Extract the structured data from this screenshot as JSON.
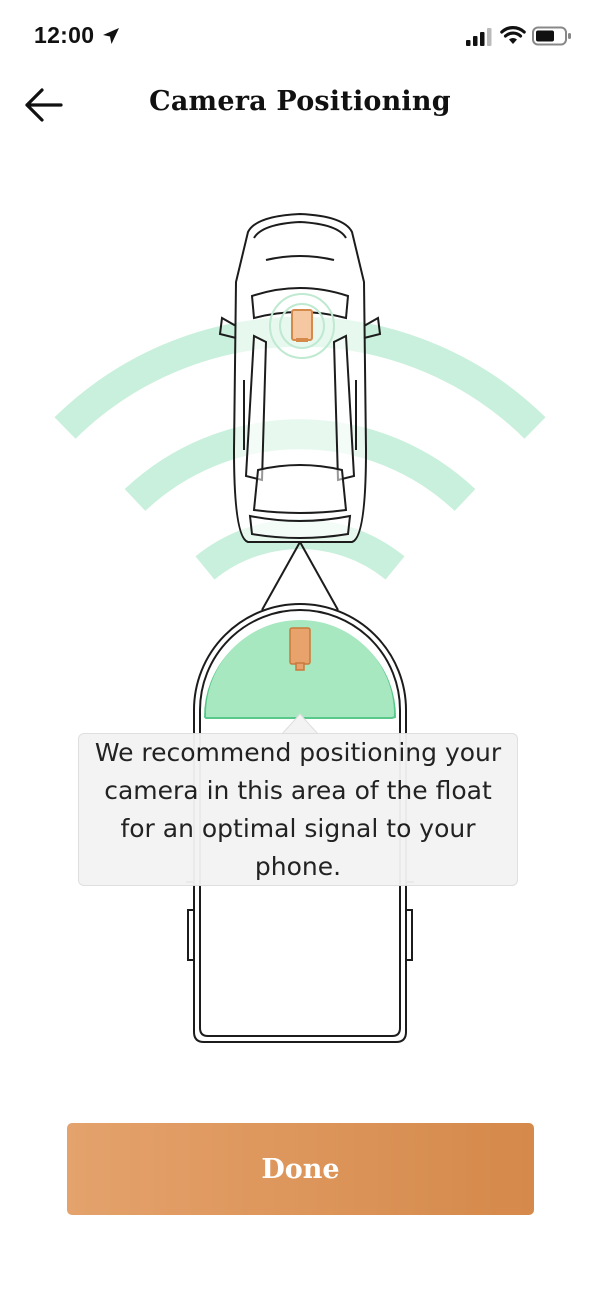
{
  "status_bar": {
    "time": "12:00",
    "location_icon": "location-arrow-icon",
    "signal_icon": "cellular-signal-icon",
    "wifi_icon": "wifi-icon",
    "battery_icon": "battery-icon"
  },
  "nav": {
    "back_icon": "arrow-left-icon",
    "title": "Camera Positioning"
  },
  "illustration": {
    "signal_color": "#c9f0dc",
    "zone_color": "#a8e8c0",
    "camera_color": "#e7a36b"
  },
  "tooltip": {
    "text": "We recommend positioning your camera in this area of the float for an optimal signal to your phone."
  },
  "done_button": {
    "label": "Done",
    "gradient_start": "#e4a26c",
    "gradient_end": "#d5894a"
  }
}
